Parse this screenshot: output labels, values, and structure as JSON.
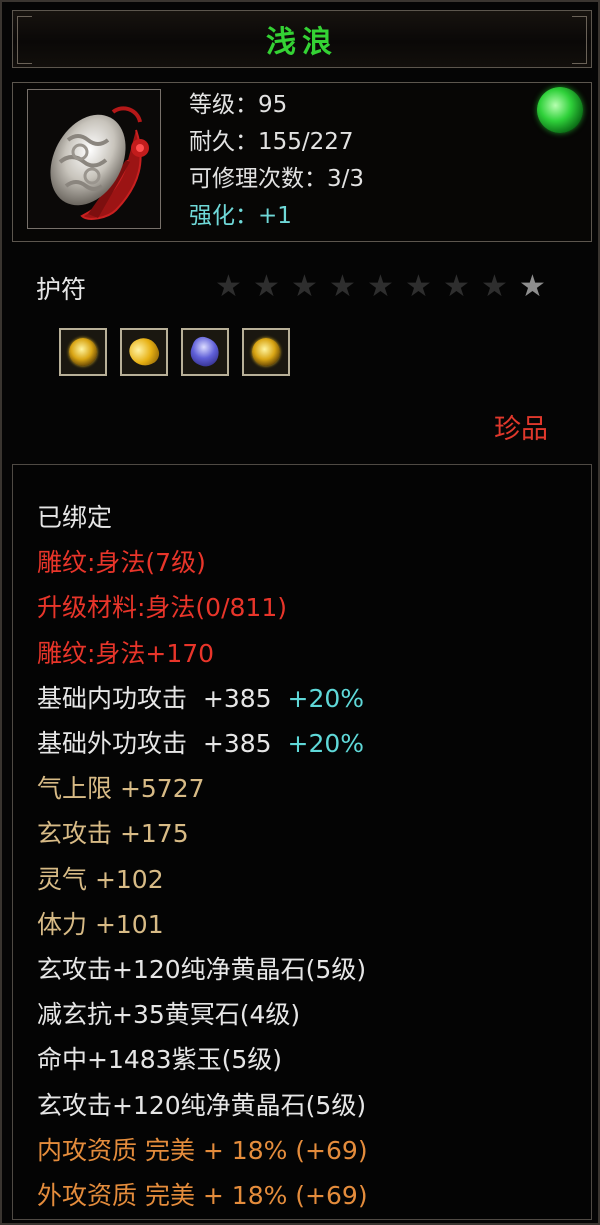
{
  "item": {
    "name": "浅浪",
    "stats": {
      "level": "等级：95",
      "durability": "耐久：155/227",
      "repairs": "可修理次数：3/3",
      "enhance": "强化：+1"
    },
    "type": "护符",
    "stars": {
      "total": 9,
      "lit": 1
    },
    "gems": [
      "yellow-crystal-gem-icon",
      "gold-nugget-gem-icon",
      "purple-jade-gem-icon",
      "yellow-crystal-gem-icon"
    ],
    "rarity": "珍品"
  },
  "attributes": {
    "bound": "已绑定",
    "engrave": "雕纹:身法(7级)",
    "upgrade": "升级材料:身法(0/811)",
    "engrave_bonus": "雕纹:身法+170",
    "inner_attack": {
      "label": "基础内功攻击",
      "value": "+385",
      "percent": "+20%"
    },
    "outer_attack": {
      "label": "基础外功攻击",
      "value": "+385",
      "percent": "+20%"
    },
    "qi_limit": "气上限  +5727",
    "mystic_attack": "玄攻击  +175",
    "spirit": "灵气  +102",
    "stamina": "体力  +101",
    "gem1": "玄攻击+120纯净黄晶石(5级)",
    "gem2": "减玄抗+35黄冥石(4级)",
    "gem3": "命中+1483紫玉(5级)",
    "gem4": "玄攻击+120纯净黄晶石(5级)",
    "inner_quality": "内攻资质  完美  +  18%  (+69)",
    "outer_quality": "外攻资质  完美  +  18%  (+69)"
  },
  "colors": {
    "title_green": "#34d234",
    "red": "#e8352a",
    "gold": "#d8bb86",
    "orange": "#e48c3c",
    "cyan": "#5fd8d8"
  }
}
